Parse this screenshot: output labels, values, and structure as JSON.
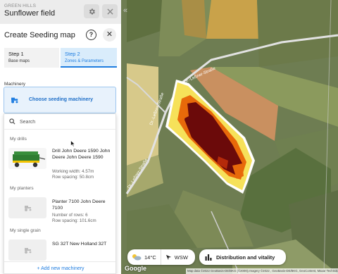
{
  "field": {
    "crumb": "GREEN HILLS",
    "title": "Sunflower field",
    "settings_icon": "gear-icon",
    "close_icon": "close-icon",
    "collapse_glyph": "«"
  },
  "panel": {
    "title": "Create Seeding map",
    "help_glyph": "?",
    "close_glyph": "✕",
    "steps": [
      {
        "num": "Step 1",
        "sub": "Base maps"
      },
      {
        "num": "Step 2",
        "sub": "Zones & Parameters"
      }
    ],
    "machinery_label": "Machinery",
    "choose_label": "Choose seeding machinery",
    "search_placeholder": "Search",
    "groups": [
      {
        "label": "My drills"
      },
      {
        "label": "My planters"
      },
      {
        "label": "My single grain"
      }
    ],
    "items": [
      {
        "name": "Drill John Deere 1590 John Deere John Deere 1590",
        "spec1": "Working width: 4.57m",
        "spec2": "Row spacing: 50.8cm"
      },
      {
        "name": "Planter 7100 John Deere 7100",
        "spec1": "Number of rows: 6",
        "spec2": "Row spacing: 101.6cm"
      },
      {
        "name": "SG 32T New Holland 32T",
        "spec1": "",
        "spec2": ""
      }
    ],
    "add_label": "+ Add new machinery"
  },
  "map": {
    "road_label_1": "Dr.-Leßner-Straße",
    "road_label_2": "Dr.-Leßner-Straße",
    "road_label_3": "Dr.-Leßner-Straße",
    "temperature": "14°C",
    "wind": "WSW",
    "layer_button": "Distribution and vitality",
    "google": "Google",
    "attribution": "Map data ©2022 GeoBasis-DE/BKG (©2009),Imagery ©2022 , GeoBasis-DE/BKG, GeoContent, Maxar Technologies"
  },
  "colors": {
    "accent": "#1f7de0",
    "zone_high": "#6b0a0a",
    "zone_mid": "#e8690a",
    "zone_low": "#f6e15a"
  }
}
